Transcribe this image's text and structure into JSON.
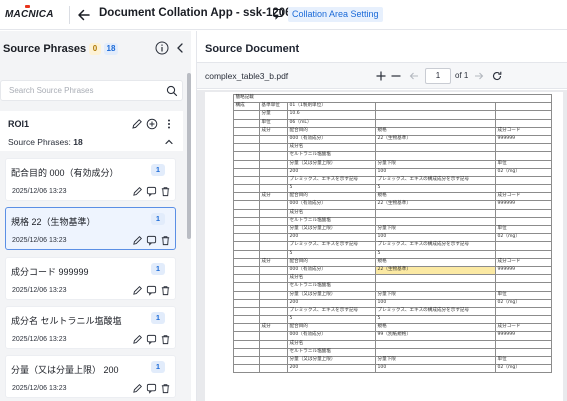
{
  "header": {
    "logo_text": "MACNICA",
    "app_title": "Document Collation App - ssk-1206",
    "area_chip": "Collation Area Setting"
  },
  "colors": {
    "accent": "#1b6ad8",
    "selected_border": "#5b8fe5",
    "logo_red": "#e8341c",
    "badge_orange": "#b07a06"
  },
  "left_panel": {
    "title": "Source Phrases",
    "count_pending": "0",
    "count_total": "18",
    "search_placeholder": "Search Source Phrases",
    "roi": {
      "label": "ROI1",
      "count_label": "Source Phrases:",
      "count_value": "18"
    },
    "cards": [
      {
        "title": "配合目的 000（有効成分）",
        "count": "1",
        "date": "2025/12/06 13:23",
        "selected": false
      },
      {
        "title": "規格 22（生物基準）",
        "count": "1",
        "date": "2025/12/06 13:23",
        "selected": true
      },
      {
        "title": "成分コード 999999",
        "count": "1",
        "date": "2025/12/06 13:23",
        "selected": false
      },
      {
        "title": "成分名 セルトラニル塩酸塩",
        "count": "1",
        "date": "2025/12/06 13:23",
        "selected": false
      },
      {
        "title": "分量（又は分量上限） 200",
        "count": "1",
        "date": "2025/12/06 13:23",
        "selected": false
      }
    ]
  },
  "right_panel": {
    "title": "Source Document",
    "file_name": "complex_table3_b.pdf",
    "page_current": "1",
    "page_total_label": "of 1"
  },
  "document": {
    "header_row": "簡略記載",
    "rows": [
      [
        "構成",
        "基準単位",
        "01（1製剤単位）",
        "",
        ""
      ],
      [
        "",
        "分量",
        "10.6",
        "",
        ""
      ],
      [
        "",
        "単位",
        "06（mL）",
        "",
        ""
      ],
      [
        "",
        "成分",
        "配合目的",
        "規格",
        "成分コード"
      ],
      [
        "",
        "",
        "000（有効成分）",
        "22（生物基準）",
        "999999"
      ],
      [
        "",
        "",
        "成分名",
        "",
        ""
      ],
      [
        "",
        "",
        "セルトラニル塩酸塩",
        "",
        ""
      ],
      [
        "",
        "",
        "分量（又は分量上限）",
        "分量下限",
        "単位"
      ],
      [
        "",
        "",
        "200",
        "100",
        "02（mg）"
      ],
      [
        "",
        "",
        "プレミックス、エキスを示す記号",
        "プレミックス、エキスの構成成分を示す記号",
        ""
      ],
      [
        "",
        "",
        "5",
        "5",
        ""
      ],
      [
        "",
        "成分",
        "配合目的",
        "規格",
        "成分コード"
      ],
      [
        "",
        "",
        "000（有効成分）",
        "22（生物基準）",
        "999999"
      ],
      [
        "",
        "",
        "成分名",
        "",
        ""
      ],
      [
        "",
        "",
        "セルトラニル塩酸塩",
        "",
        ""
      ],
      [
        "",
        "",
        "分量（又は分量上限）",
        "分量下限",
        "単位"
      ],
      [
        "",
        "",
        "200",
        "100",
        "02（mg）"
      ],
      [
        "",
        "",
        "プレミックス、エキスを示す記号",
        "プレミックス、エキスの構成成分を示す記号",
        ""
      ],
      [
        "",
        "",
        "5",
        "5",
        ""
      ],
      [
        "",
        "成分",
        "配合目的",
        "規格",
        "成分コード"
      ],
      [
        "",
        "",
        "000（有効成分）",
        "22（生物基準）",
        "999999"
      ],
      [
        "",
        "",
        "成分名",
        "",
        ""
      ],
      [
        "",
        "",
        "セルトラニル塩酸塩",
        "",
        ""
      ],
      [
        "",
        "",
        "分量（又は分量上限）",
        "分量下限",
        "単位"
      ],
      [
        "",
        "",
        "200",
        "100",
        "02（mg）"
      ],
      [
        "",
        "",
        "プレミックス、エキスを示す記号",
        "プレミックス、エキスの構成成分を示す記号",
        ""
      ],
      [
        "",
        "",
        "5",
        "5",
        ""
      ],
      [
        "",
        "成分",
        "配合目的",
        "規格",
        "成分コード"
      ],
      [
        "",
        "",
        "000（有効成分）",
        "99（別紙規格）",
        "999999"
      ],
      [
        "",
        "",
        "成分名",
        "",
        ""
      ],
      [
        "",
        "",
        "セルトラニル塩酸塩",
        "",
        ""
      ],
      [
        "",
        "",
        "分量（又は分量上限）",
        "分量下限",
        "単位"
      ],
      [
        "",
        "",
        "200",
        "100",
        "02（mg）"
      ]
    ],
    "highlight_cell": [
      20,
      3
    ]
  }
}
